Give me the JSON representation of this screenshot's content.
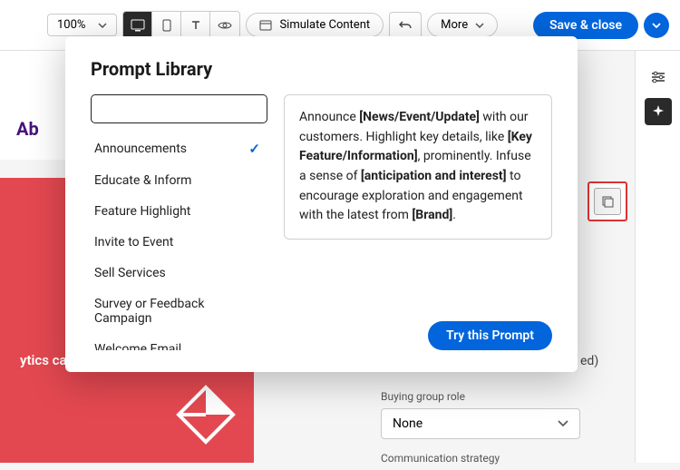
{
  "toolbar": {
    "zoom": "100%",
    "simulate_label": "Simulate Content",
    "more_label": "More",
    "save_close_label": "Save & close"
  },
  "canvas": {
    "heading_fragment": "Ab",
    "red_text_fragment": "ytics ca"
  },
  "modal": {
    "title": "Prompt Library",
    "search_placeholder": "",
    "items": [
      {
        "label": "Announcements",
        "selected": true
      },
      {
        "label": "Educate & Inform",
        "selected": false
      },
      {
        "label": "Feature Highlight",
        "selected": false
      },
      {
        "label": "Invite to Event",
        "selected": false
      },
      {
        "label": "Sell Services",
        "selected": false
      },
      {
        "label": "Survey or Feedback Campaign",
        "selected": false
      },
      {
        "label": "Welcome Email",
        "selected": false
      }
    ],
    "preview": {
      "t1": "Announce ",
      "b1": "[News/Event/Update]",
      "t2": " with our customers. Highlight key details, like ",
      "b2": "[Key Feature/Information]",
      "t3": ", prominently. Infuse a sense of ",
      "b3": "[anticipation and interest]",
      "t4": " to encourage exploration and engagement with the latest from ",
      "b4": "[Brand]",
      "t5": "."
    },
    "try_label": "Try this Prompt"
  },
  "panel": {
    "truncated_suffix": "ed)",
    "buying_group_label": "Buying group role",
    "buying_group_value": "None",
    "communication_label": "Communication strategy"
  }
}
